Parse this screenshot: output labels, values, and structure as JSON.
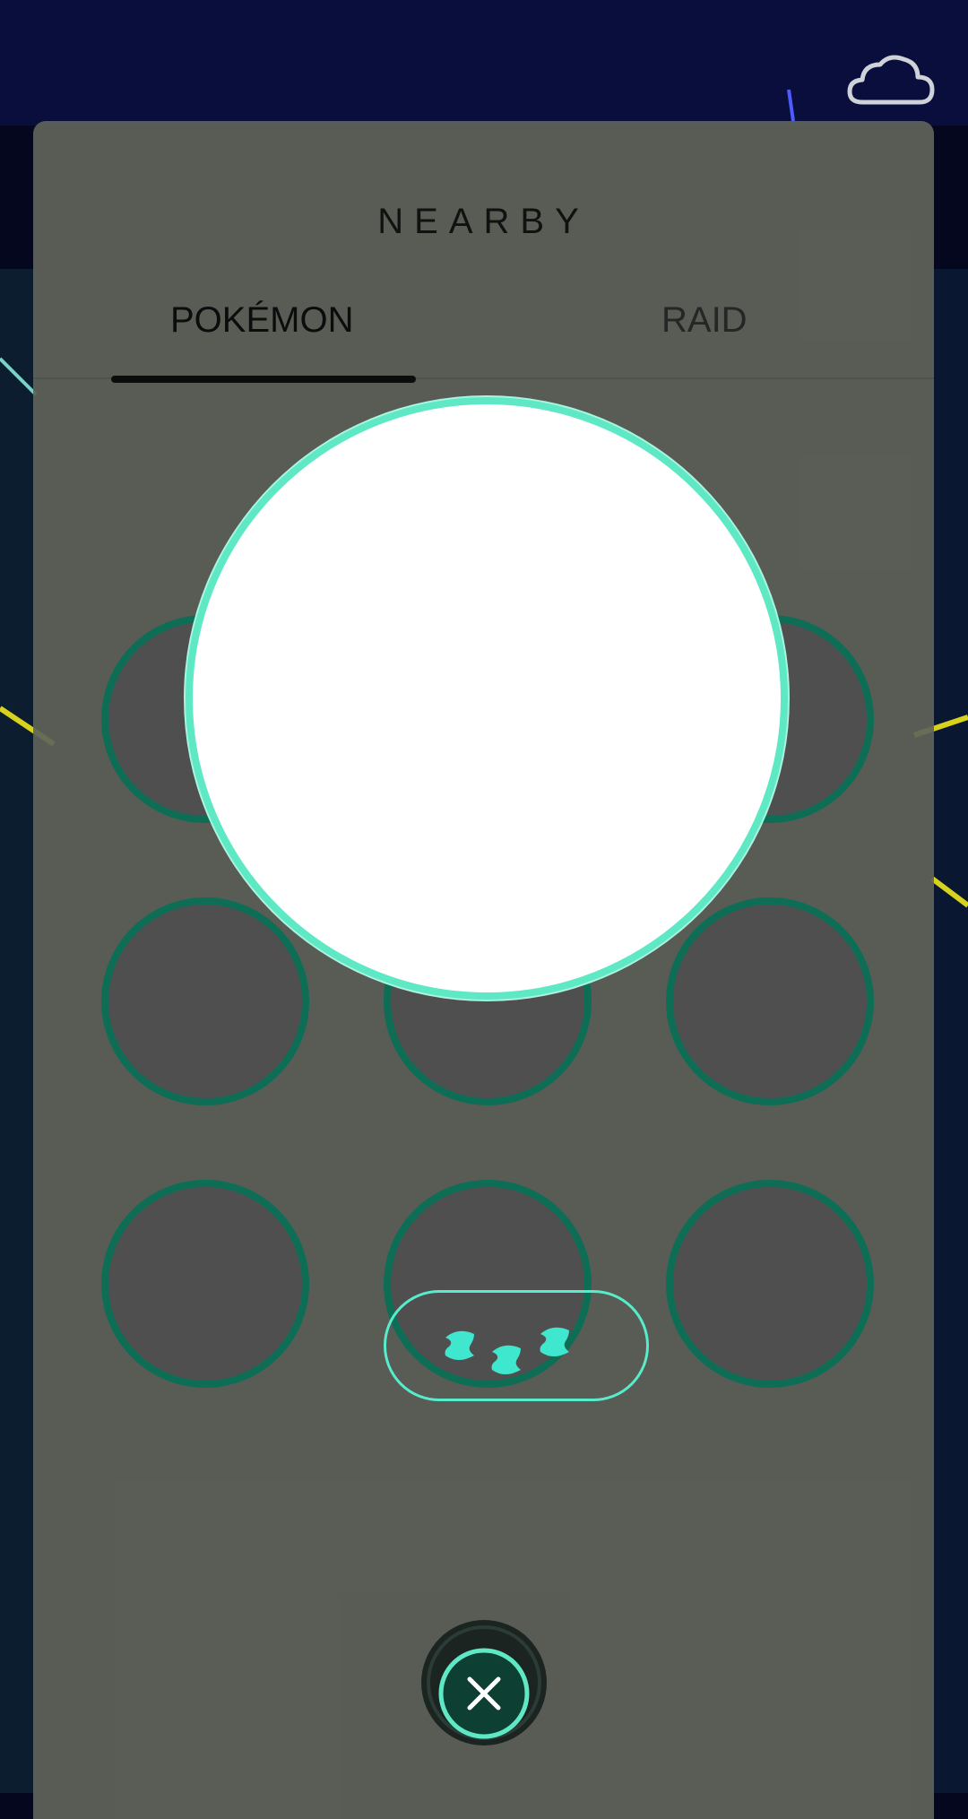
{
  "header": {
    "title": "NEARBY"
  },
  "tabs": [
    {
      "label": "POKÉMON",
      "active": true
    },
    {
      "label": "RAID",
      "active": false
    }
  ],
  "icons": {
    "weather": "cloud-icon",
    "close": "close-icon",
    "tracks": "footprint-icon"
  },
  "colors": {
    "accent": "#5fe8c4",
    "slot_ring": "#0e6e55",
    "panel": "#60645a"
  }
}
